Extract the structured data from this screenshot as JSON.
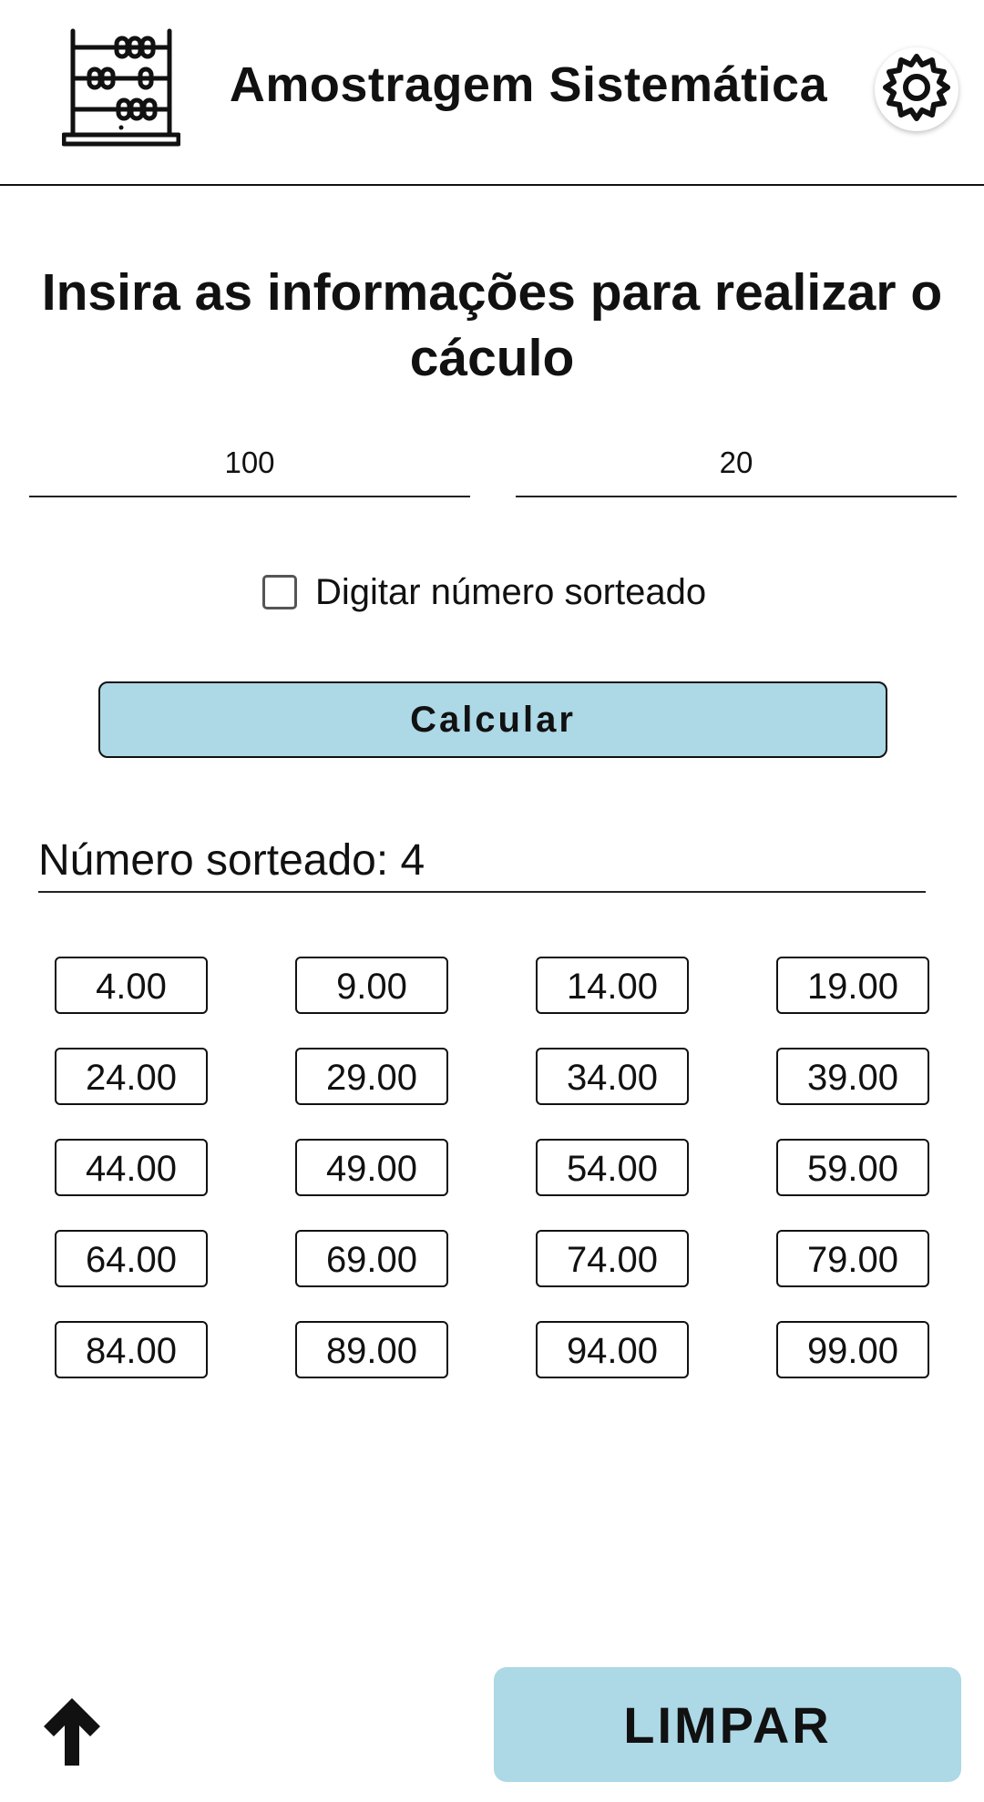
{
  "header": {
    "title": "Amostragem Sistemática",
    "logo_icon": "abacus-icon",
    "settings_icon": "gear-icon"
  },
  "form": {
    "instructions": "Insira as informações para realizar o cáculo",
    "population_value": "100",
    "sample_value": "20",
    "checkbox_label": "Digitar número sorteado",
    "checkbox_checked": false,
    "calculate_label": "Calcular"
  },
  "result": {
    "drawn_number_label": "Número sorteado: 4",
    "values": [
      "4.00",
      "9.00",
      "14.00",
      "19.00",
      "24.00",
      "29.00",
      "34.00",
      "39.00",
      "44.00",
      "49.00",
      "54.00",
      "59.00",
      "64.00",
      "69.00",
      "74.00",
      "79.00",
      "84.00",
      "89.00",
      "94.00",
      "99.00"
    ]
  },
  "footer": {
    "scroll_up_icon": "arrow-up-icon",
    "clear_label": "LIMPAR"
  },
  "colors": {
    "accent": "#add8e6",
    "text": "#111111",
    "background": "#ffffff"
  }
}
